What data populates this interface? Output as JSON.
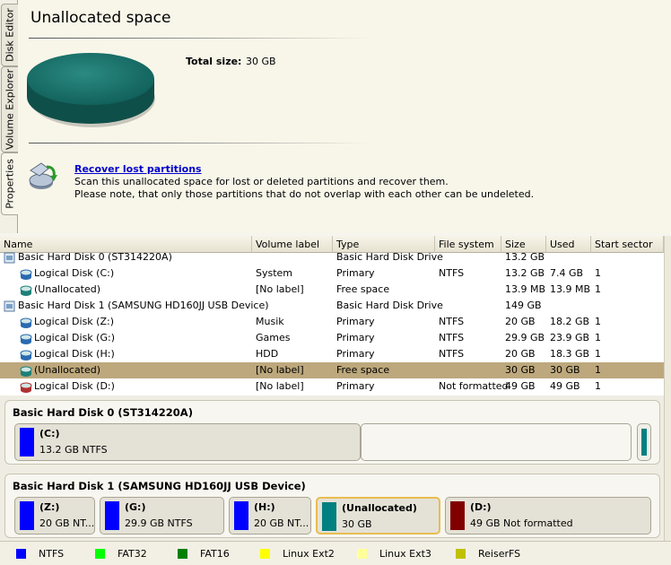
{
  "side_tabs": [
    "Disk Editor",
    "Volume Explorer",
    "Properties"
  ],
  "props": {
    "title": "Unallocated space",
    "total_label": "Total size:",
    "total_value": "30 GB",
    "recover_link": "Recover lost partitions",
    "recover_desc1": "Scan this unallocated space for lost or deleted partitions and recover them.",
    "recover_desc2": "Please note, that only those partitions that do not overlap with each other can be undeleted."
  },
  "columns": [
    "Name",
    "Volume label",
    "Type",
    "File system",
    "Size",
    "Used",
    "Start sector"
  ],
  "rows": [
    {
      "level": 0,
      "icon": "hard-disk-icon",
      "name": "Basic Hard Disk 0 (ST314220A)",
      "label": "",
      "type": "Basic Hard Disk Drive",
      "fs": "",
      "size": "13.2 GB",
      "used": "",
      "start": ""
    },
    {
      "level": 1,
      "icon": "ntfs-partition-icon",
      "name": "Logical Disk (C:)",
      "label": "System",
      "type": "Primary",
      "fs": "NTFS",
      "size": "13.2 GB",
      "used": "7.4 GB",
      "start": "1"
    },
    {
      "level": 1,
      "icon": "unallocated-partition-icon",
      "name": "(Unallocated)",
      "label": "[No label]",
      "type": "Free space",
      "fs": "",
      "size": "13.9 MB",
      "used": "13.9 MB",
      "start": "1"
    },
    {
      "level": 0,
      "icon": "hard-disk-icon",
      "name": "Basic Hard Disk 1 (SAMSUNG HD160JJ USB Device)",
      "label": "",
      "type": "Basic Hard Disk Drive",
      "fs": "",
      "size": "149 GB",
      "used": "",
      "start": ""
    },
    {
      "level": 1,
      "icon": "ntfs-partition-icon",
      "name": "Logical Disk (Z:)",
      "label": "Musik",
      "type": "Primary",
      "fs": "NTFS",
      "size": "20 GB",
      "used": "18.2 GB",
      "start": "1"
    },
    {
      "level": 1,
      "icon": "ntfs-partition-icon",
      "name": "Logical Disk (G:)",
      "label": "Games",
      "type": "Primary",
      "fs": "NTFS",
      "size": "29.9 GB",
      "used": "23.9 GB",
      "start": "1"
    },
    {
      "level": 1,
      "icon": "ntfs-partition-icon",
      "name": "Logical Disk (H:)",
      "label": "HDD",
      "type": "Primary",
      "fs": "NTFS",
      "size": "20 GB",
      "used": "18.3 GB",
      "start": "1"
    },
    {
      "level": 1,
      "icon": "unallocated-partition-icon",
      "name": "(Unallocated)",
      "label": "[No label]",
      "type": "Free space",
      "fs": "",
      "size": "30 GB",
      "used": "30 GB",
      "start": "1",
      "selected": true
    },
    {
      "level": 1,
      "icon": "unformatted-partition-icon",
      "name": "Logical Disk (D:)",
      "label": "[No label]",
      "type": "Primary",
      "fs": "Not formatted",
      "size": "49 GB",
      "used": "49 GB",
      "start": "1"
    }
  ],
  "disk_map": {
    "disk0": {
      "title": "Basic Hard Disk 0 (ST314220A)",
      "partitions": [
        {
          "name": "(C:)",
          "desc": "13.2 GB NTFS",
          "color": "#0000ff"
        }
      ]
    },
    "disk1": {
      "title": "Basic Hard Disk 1 (SAMSUNG HD160JJ USB Device)",
      "partitions": [
        {
          "name": "(Z:)",
          "desc": "20 GB NT...",
          "color": "#0000ff"
        },
        {
          "name": "(G:)",
          "desc": "29.9 GB NTFS",
          "color": "#0000ff"
        },
        {
          "name": "(H:)",
          "desc": "20 GB NT...",
          "color": "#0000ff"
        },
        {
          "name": "(Unallocated)",
          "desc": "30 GB",
          "color": "#008080",
          "selected": true
        },
        {
          "name": "(D:)",
          "desc": "49 GB Not formatted",
          "color": "#800000"
        }
      ]
    }
  },
  "legend": [
    {
      "label": "NTFS",
      "color": "#0000ff"
    },
    {
      "label": "FAT32",
      "color": "#00ff00"
    },
    {
      "label": "FAT16",
      "color": "#008000"
    },
    {
      "label": "Linux Ext2",
      "color": "#ffff00"
    },
    {
      "label": "Linux Ext3",
      "color": "#ffff99"
    },
    {
      "label": "ReiserFS",
      "color": "#c0c000"
    }
  ]
}
